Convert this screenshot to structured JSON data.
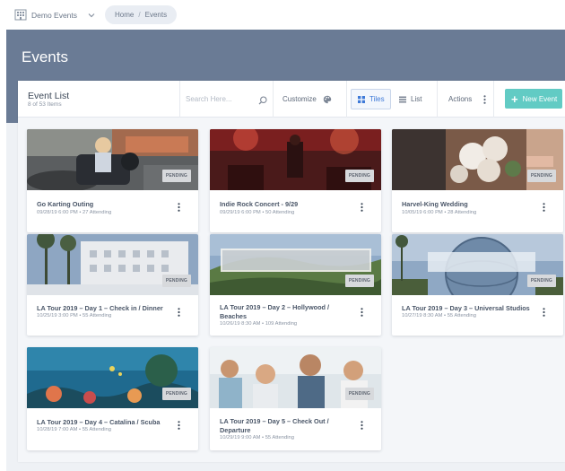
{
  "org": {
    "name": "Demo Events",
    "icon": "building-icon"
  },
  "breadcrumb": {
    "home": "Home",
    "separator": "/",
    "current": "Events"
  },
  "page": {
    "title": "Events"
  },
  "toolbar": {
    "title": "Event List",
    "subtitle": "8 of 53 Items",
    "search_placeholder": "Search Here...",
    "customize_label": "Customize",
    "tiles_label": "Tiles",
    "list_label": "List",
    "actions_label": "Actions",
    "new_label": "New Event",
    "accent_color": "#3e7ad8",
    "new_button_color": "#62cbc4"
  },
  "events": [
    {
      "title": "Go Karting Outing",
      "meta": "09/28/19 6:00 PM • 27 Attending",
      "status": "PENDING",
      "image": "go-karting-photo"
    },
    {
      "title": "Indie Rock Concert - 9/29",
      "meta": "09/29/19 6:00 PM • 50 Attending",
      "status": "PENDING",
      "image": "rock-concert-photo"
    },
    {
      "title": "Harvel-King Wedding",
      "meta": "10/05/19 6:00 PM • 28 Attending",
      "status": "PENDING",
      "image": "wedding-photo"
    },
    {
      "title": "LA Tour 2019 – Day 1 – Check in / Dinner",
      "meta": "10/25/19 3:00 PM • 55 Attending",
      "status": "PENDING",
      "image": "hotel-photo"
    },
    {
      "title": "LA Tour 2019 – Day 2 – Hollywood / Beaches",
      "meta": "10/26/19 8:30 AM • 109 Attending",
      "status": "PENDING",
      "image": "hollywood-sign-photo"
    },
    {
      "title": "LA Tour 2019 – Day 3 – Universal Studios",
      "meta": "10/27/19 8:30 AM • 55 Attending",
      "status": "PENDING",
      "image": "universal-globe-photo"
    },
    {
      "title": "LA Tour 2019 – Day 4 – Catalina / Scuba",
      "meta": "10/28/19 7:00 AM • 55 Attending",
      "status": "PENDING",
      "image": "coral-reef-photo"
    },
    {
      "title": "LA Tour 2019 – Day 5 – Check Out / Departure",
      "meta": "10/29/19 9:00 AM • 55 Attending",
      "status": "PENDING",
      "image": "friends-selfie-photo"
    }
  ]
}
